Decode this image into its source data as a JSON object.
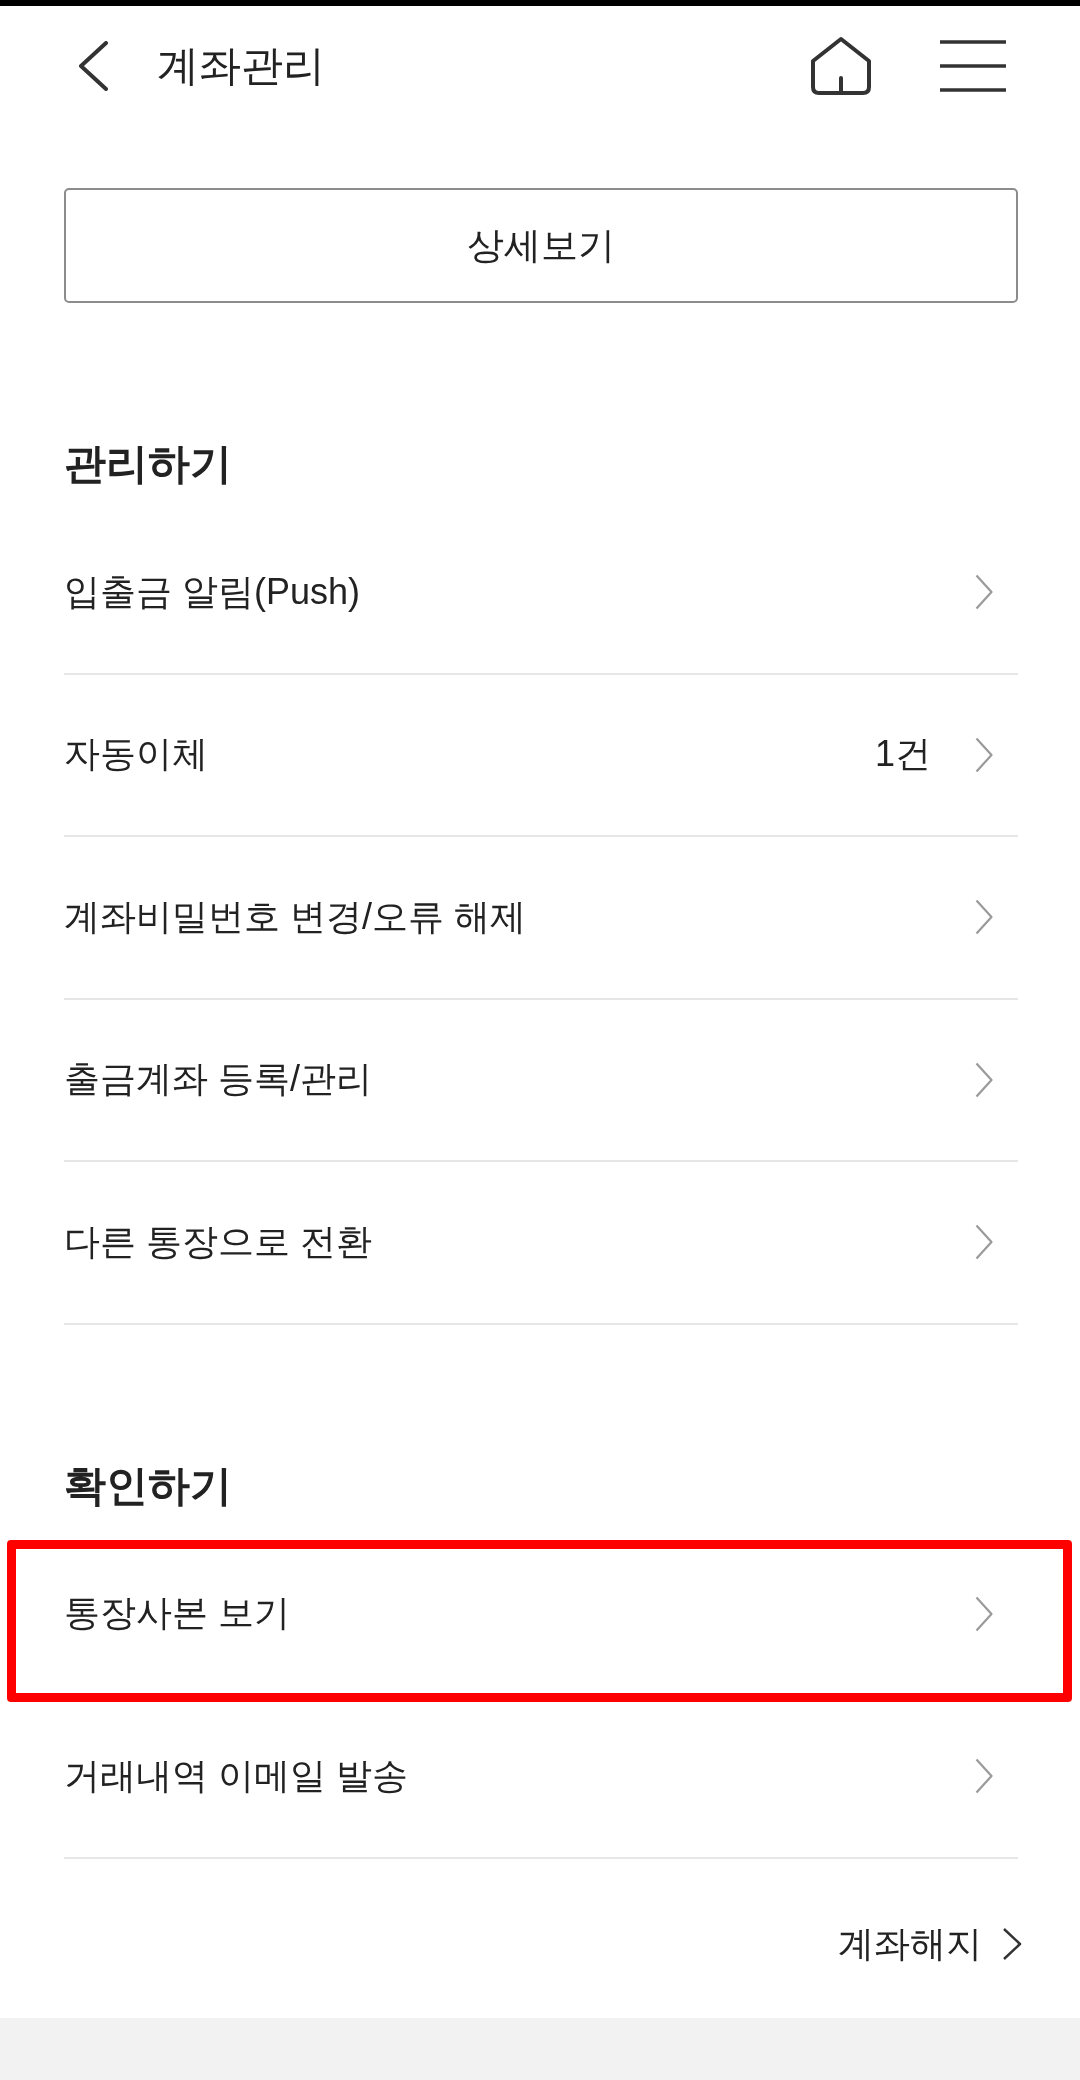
{
  "header": {
    "title": "계좌관리"
  },
  "detail_button": {
    "label": "상세보기"
  },
  "sections": [
    {
      "title": "관리하기",
      "items": [
        {
          "label": "입출금 알림(Push)",
          "highlighted": false
        },
        {
          "label": "자동이체",
          "count": "1건",
          "highlighted": false
        },
        {
          "label": "계좌비밀번호 변경/오류 해제",
          "highlighted": false
        },
        {
          "label": "출금계좌 등록/관리",
          "highlighted": false
        },
        {
          "label": "다른 통장으로 전환",
          "highlighted": false
        }
      ]
    },
    {
      "title": "확인하기",
      "items": [
        {
          "label": "통장사본 보기",
          "highlighted": true
        },
        {
          "label": "거래내역 이메일 발송",
          "highlighted": false
        }
      ]
    }
  ],
  "close_account_link": {
    "label": "계좌해지"
  }
}
